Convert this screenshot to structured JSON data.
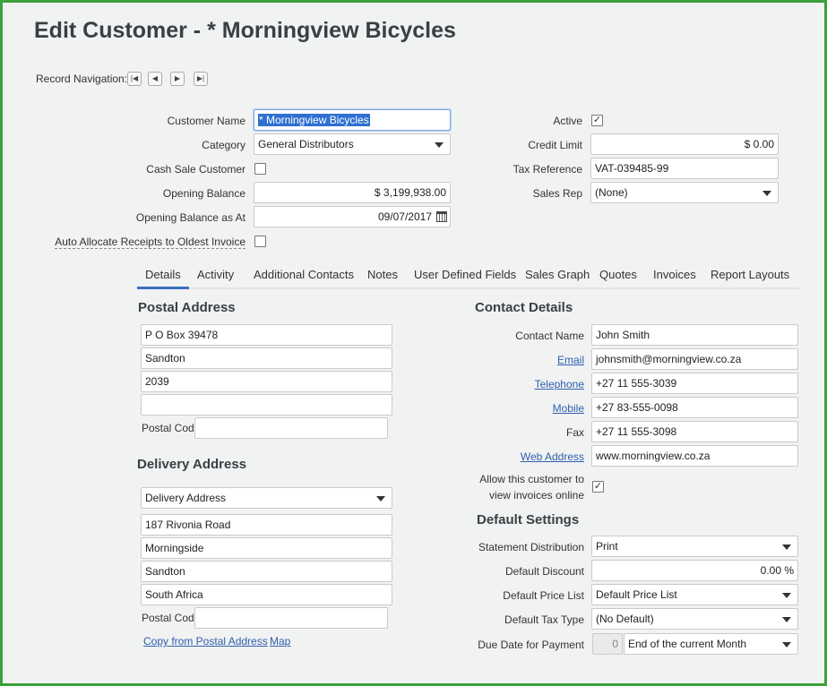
{
  "title": "Edit Customer - * Morningview Bicycles",
  "record_nav": {
    "label": "Record Navigation:"
  },
  "header": {
    "customer_name_label": "Customer Name",
    "customer_name_value": "* Morningview Bicycles",
    "category_label": "Category",
    "category_value": "General Distributors",
    "cash_sale_label": "Cash Sale Customer",
    "cash_sale_checked": false,
    "opening_balance_label": "Opening Balance",
    "opening_balance_value": "$ 3,199,938.00",
    "opening_balance_as_at_label": "Opening Balance as At",
    "opening_balance_as_at_value": "09/07/2017",
    "auto_allocate_label": "Auto Allocate Receipts to Oldest Invoice",
    "auto_allocate_checked": false,
    "active_label": "Active",
    "active_check": "✓",
    "credit_limit_label": "Credit Limit",
    "credit_limit_value": "$ 0.00",
    "tax_reference_label": "Tax Reference",
    "tax_reference_value": "VAT-039485-99",
    "sales_rep_label": "Sales Rep",
    "sales_rep_value": "(None)"
  },
  "tabs": [
    {
      "label": "Details",
      "active": true
    },
    {
      "label": "Activity"
    },
    {
      "label": "Additional Contacts"
    },
    {
      "label": "Notes"
    },
    {
      "label": "User Defined Fields"
    },
    {
      "label": "Sales Graph"
    },
    {
      "label": "Quotes"
    },
    {
      "label": "Invoices"
    },
    {
      "label": "Report Layouts"
    }
  ],
  "postal": {
    "heading": "Postal Address",
    "line1": "P O Box 39478",
    "line2": "Sandton",
    "line3": "2039",
    "line4": "",
    "postal_code_label": "Postal Code",
    "postal_code_value": ""
  },
  "delivery": {
    "heading": "Delivery Address",
    "select_value": "Delivery Address",
    "line1": "187 Rivonia Road",
    "line2": "Morningside",
    "line3": "Sandton",
    "line4": "South Africa",
    "postal_code_label": "Postal Code",
    "postal_code_value": "",
    "copy_link": "Copy from Postal Address",
    "map_link": "Map"
  },
  "contact": {
    "heading": "Contact Details",
    "contact_name_label": "Contact Name",
    "contact_name_value": "John Smith",
    "email_label": "Email",
    "email_value": "johnsmith@morningview.co.za",
    "telephone_label": "Telephone",
    "telephone_value": "+27 11 555-3039",
    "mobile_label": "Mobile",
    "mobile_value": "+27 83-555-0098",
    "fax_label": "Fax",
    "fax_value": "+27 11 555-3098",
    "web_label": "Web Address",
    "web_value": "www.morningview.co.za",
    "allow_line1": "Allow this customer to",
    "allow_line2": "view invoices online",
    "allow_check": "✓"
  },
  "defaults": {
    "heading": "Default Settings",
    "statement_label": "Statement Distribution",
    "statement_value": "Print",
    "discount_label": "Default Discount",
    "discount_value": "0.00 %",
    "price_list_label": "Default Price List",
    "price_list_value": "Default Price List",
    "tax_type_label": "Default Tax Type",
    "tax_type_value": "(No Default)",
    "due_date_label": "Due Date for Payment",
    "due_days_value": "0",
    "due_date_value": "End of the current Month"
  },
  "colors": {
    "accent": "#3a6fbf",
    "frame": "#3aa23a",
    "link": "#2f5fae"
  }
}
